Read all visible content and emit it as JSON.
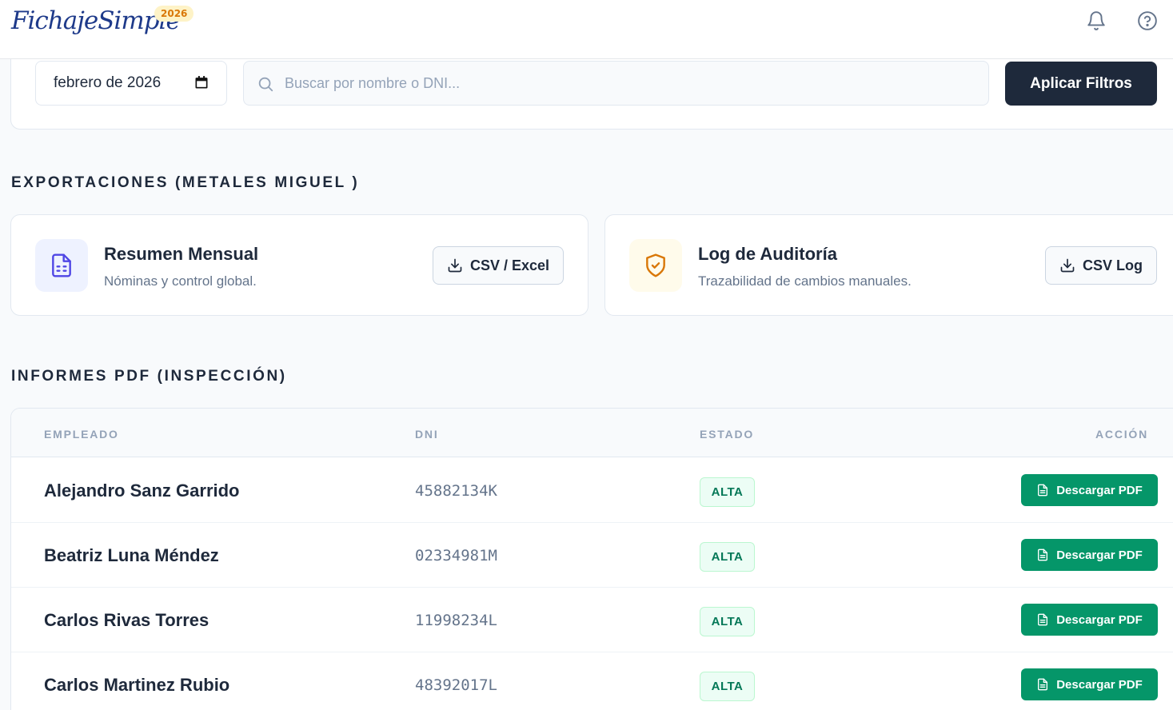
{
  "header": {
    "logo": "FichajeSimple",
    "badge": "2026"
  },
  "filters": {
    "month_value": "febrero de 2026",
    "search_placeholder": "Buscar por nombre o DNI...",
    "apply_label": "Aplicar Filtros"
  },
  "exports": {
    "section_title": "EXPORTACIONES (METALES MIGUEL )",
    "cards": [
      {
        "title": "Resumen Mensual",
        "subtitle": "Nóminas y control global.",
        "button": "CSV / Excel",
        "icon": "file-spreadsheet-icon",
        "accent": "#4f46e5"
      },
      {
        "title": "Log de Auditoría",
        "subtitle": "Trazabilidad de cambios manuales.",
        "button": "CSV Log",
        "icon": "shield-check-icon",
        "accent": "#d97706"
      }
    ]
  },
  "reports": {
    "section_title": "INFORMES PDF (INSPECCIÓN)",
    "columns": [
      "EMPLEADO",
      "DNI",
      "ESTADO",
      "ACCIÓN"
    ],
    "rows": [
      {
        "name": "Alejandro Sanz Garrido",
        "dni": "45882134K",
        "status": "ALTA",
        "action": "Descargar PDF"
      },
      {
        "name": "Beatriz Luna Méndez",
        "dni": "02334981M",
        "status": "ALTA",
        "action": "Descargar PDF"
      },
      {
        "name": "Carlos Rivas Torres",
        "dni": "11998234L",
        "status": "ALTA",
        "action": "Descargar PDF"
      },
      {
        "name": "Carlos Martinez Rubio",
        "dni": "48392017L",
        "status": "ALTA",
        "action": "Descargar PDF"
      }
    ]
  },
  "colors": {
    "primary_dark": "#1e293b",
    "success": "#059669",
    "brand": "#1e3a8a"
  }
}
